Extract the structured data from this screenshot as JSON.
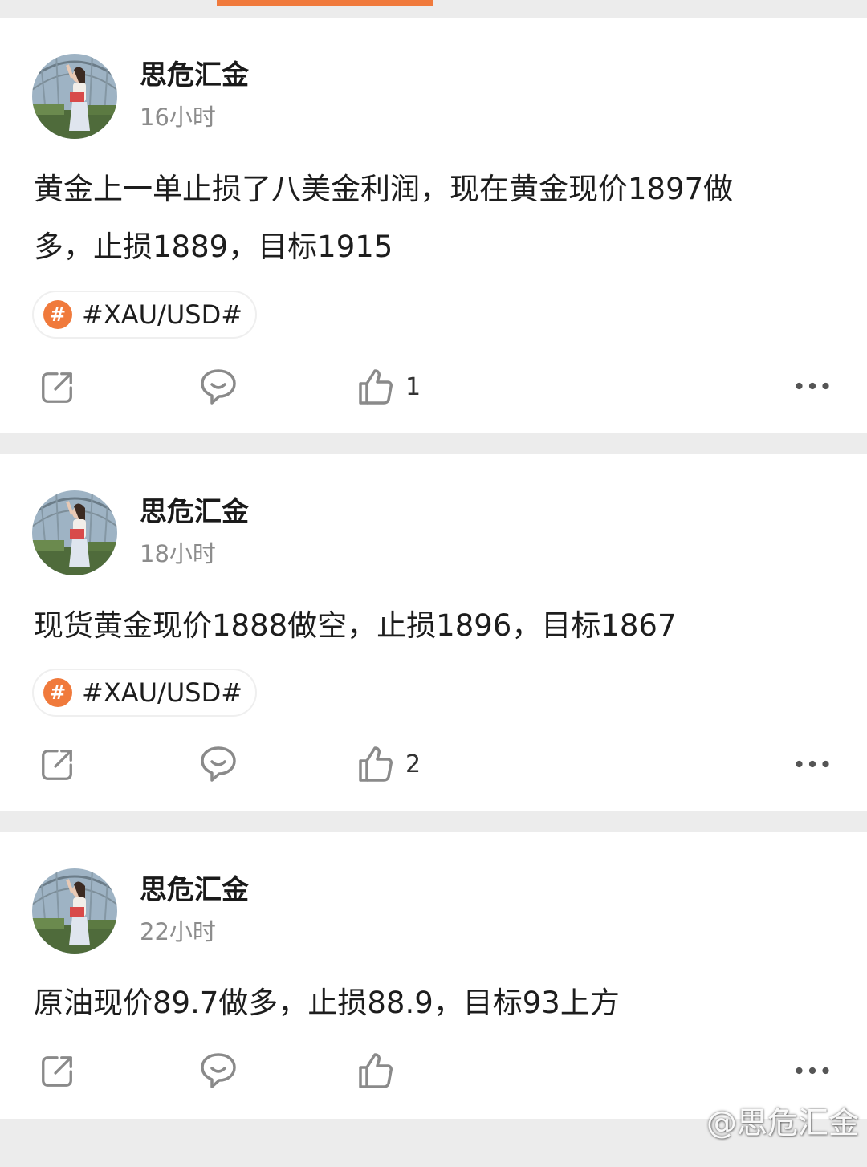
{
  "colors": {
    "accent": "#f07a3c",
    "background": "#ececec",
    "card": "#ffffff",
    "time_text": "#8c8c8c"
  },
  "posts": [
    {
      "author": "思危汇金",
      "time": "16小时",
      "text_line1": "黄金上一单止损了八美金利润，现在黄金现价1897做",
      "text_line2": "多，止损1889，目标1915",
      "tag": "#XAU/USD#",
      "like_count": "1"
    },
    {
      "author": "思危汇金",
      "time": "18小时",
      "text_line1": "现货黄金现价1888做空，止损1896，目标1867",
      "tag": "#XAU/USD#",
      "like_count": "2"
    },
    {
      "author": "思危汇金",
      "time": "22小时",
      "text_line1": "原油现价89.7做多，止损88.9，目标93上方",
      "like_count": ""
    }
  ],
  "watermark": "@思危汇金",
  "icons": {
    "share": "share-icon",
    "comment": "comment-icon",
    "like": "thumbs-up-icon",
    "more": "more-dots-icon",
    "hash": "hash-topic-icon"
  }
}
